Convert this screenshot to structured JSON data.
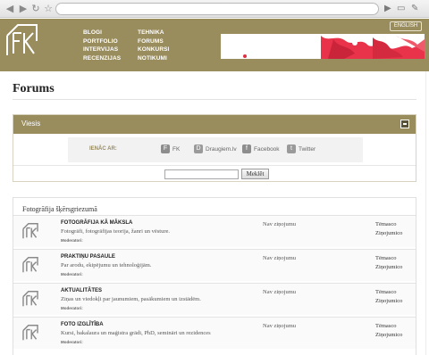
{
  "browser": {
    "back_icon": "arrow-left-icon",
    "forward_icon": "arrow-right-icon",
    "reload_icon": "reload-icon",
    "star_icon": "star-icon"
  },
  "header": {
    "logo_text": "FK",
    "menu_left": [
      "BLOGI",
      "PORTFOLIO",
      "INTERVIJAS",
      "RECENZIJAS"
    ],
    "menu_right": [
      "TEHNIKA",
      "FORUMS",
      "KONKURSI",
      "NOTIKUMI"
    ],
    "language": "ENGLISH",
    "bg_color": "#998c5d"
  },
  "page": {
    "title": "Forums"
  },
  "guests": {
    "heading": "Viesis",
    "login_label": "IENĀC AR:",
    "providers": [
      {
        "label": "FK",
        "icon": "fk-icon",
        "color": "#7a7a7a"
      },
      {
        "label": "Draugiem.lv",
        "icon": "draugiem-icon",
        "color": "#8a8a8a"
      },
      {
        "label": "Facebook",
        "icon": "facebook-icon",
        "color": "#7a7a7a"
      },
      {
        "label": "Twitter",
        "icon": "twitter-icon",
        "color": "#8a8a8a"
      }
    ],
    "search_value": "",
    "search_button": "Meklēt"
  },
  "forum": {
    "category": "Fotogrāfija šķērsgriezumā",
    "rows": [
      {
        "title": "FOTOGRĀFIJA KĀ MĀKSLA",
        "desc": "Fotogrāfi, fotogrāfijas teorija, žanri un vēsture.",
        "mod": "Moderatori:",
        "last": "Nav ziņojumu",
        "topics": "Tēmasco",
        "posts": "Ziņojumico"
      },
      {
        "title": "PRAKTIŅU PASAULE",
        "desc": "Par arodu, ekipējumu un tehnoloģijām.",
        "mod": "Moderatori:",
        "last": "Nav ziņojumu",
        "topics": "Tēmasco",
        "posts": "Ziņojumico"
      },
      {
        "title": "AKTUALITĀTES",
        "desc": "Ziņas un viedokļi par jaunumiem, pasākumiem un izstādēm.",
        "mod": "Moderatori:",
        "last": "Nav ziņojumu",
        "topics": "Tēmasco",
        "posts": "Ziņojumico"
      },
      {
        "title": "FOTO IZGLĪTĪBA",
        "desc": "Kursi, bakalaura un maģistra grādi, PhD, semināri un rezidences",
        "mod": "Moderatori:",
        "last": "Nav ziņojumu",
        "topics": "Tēmasco",
        "posts": "Ziņojumico"
      }
    ]
  }
}
